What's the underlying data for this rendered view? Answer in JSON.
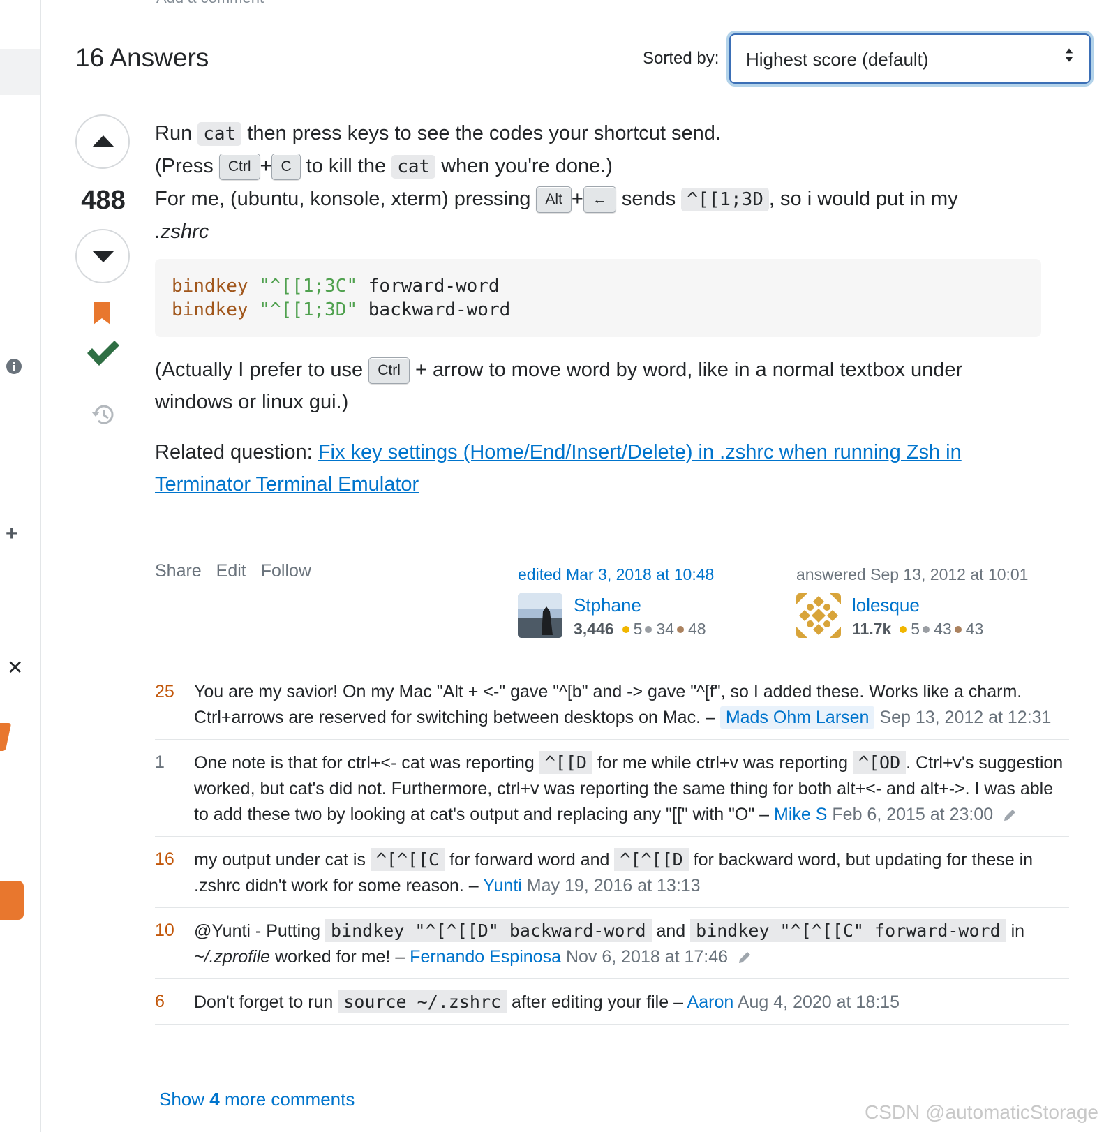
{
  "top_link": "Add a comment",
  "answers_header": {
    "count_label": "16 Answers",
    "sort_label": "Sorted by:",
    "sort_value": "Highest score (default)"
  },
  "answer": {
    "score": "488",
    "body": {
      "p1_a": "Run ",
      "p1_code": "cat",
      "p1_b": " then press keys to see the codes your shortcut send.",
      "p2_a": "(Press ",
      "key_ctrl": "Ctrl",
      "plus": "+",
      "key_c": "C",
      "p2_b": " to kill the ",
      "p2_code": "cat",
      "p2_c": " when you're done.)",
      "p3_a": "For me, (ubuntu, konsole, xterm) pressing ",
      "key_alt": "Alt",
      "key_left": "←",
      "p3_b": " sends ",
      "p3_code": "^[[1;3D",
      "p3_c": ", so i would put in my",
      "p3_d": ".zshrc",
      "code_line1_kw": "bindkey",
      "code_line1_str": "\"^[[1;3C\"",
      "code_line1_rest": " forward-word",
      "code_line2_kw": "bindkey",
      "code_line2_str": "\"^[[1;3D\"",
      "code_line2_rest": " backward-word",
      "p4_a": "(Actually I prefer to use ",
      "p4_b": " + arrow to move word by word, like in a normal textbox under",
      "p4_c": "windows or linux gui.)",
      "p5_a": "Related question: ",
      "p5_link1": "Fix key settings (Home/End/Insert/Delete) in .zshrc when running Zsh in",
      "p5_link2": "Terminator Terminal Emulator"
    },
    "menu": [
      "Share",
      "Edit",
      "Follow"
    ],
    "editor": {
      "action": "edited Mar 3, 2018 at 10:48",
      "name": "Stphane",
      "rep": "3,446",
      "gold": "5",
      "silver": "34",
      "bronze": "48"
    },
    "author": {
      "action": "answered Sep 13, 2012 at 10:01",
      "name": "lolesque",
      "rep": "11.7k",
      "gold": "5",
      "silver": "43",
      "bronze": "43"
    }
  },
  "comments": [
    {
      "score": "25",
      "text_a": "You are my savior! On my Mac \"Alt + <-\" gave \"^[b\" and -> gave \"^[f\", so I added these. Works like a charm. Ctrl+arrows are reserved for switching between desktops on Mac. – ",
      "user": "Mads Ohm Larsen",
      "date": "Sep 13, 2012 at 12:31"
    },
    {
      "score": "1",
      "text_a": "One note is that for ctrl+<- cat was reporting ",
      "code_a": "^[[D",
      "text_b": " for me while ctrl+v was reporting ",
      "code_b": "^[OD",
      "text_c": ". Ctrl+v's suggestion worked, but cat's did not. Furthermore, ctrl+v was reporting the same thing for both alt+<- and alt+->. I was able to add these two by looking at cat's output and replacing any \"[[\" with \"O\" – ",
      "user": "Mike S",
      "date": "Feb 6, 2015 at 23:00"
    },
    {
      "score": "16",
      "text_a": "my output under cat is ",
      "code_a": "^[^[[C",
      "text_b": " for forward word and ",
      "code_b": "^[^[[D",
      "text_c": " for backward word, but updating for these in .zshrc didn't work for some reason. – ",
      "user": "Yunti",
      "date": "May 19, 2016 at 13:13"
    },
    {
      "score": "10",
      "text_a": "@Yunti - Putting ",
      "code_a": "bindkey \"^[^[[D\" backward-word",
      "text_b": " and ",
      "code_b": "bindkey \"^[^[[C\" forward-word",
      "text_c": " in ",
      "text_em": "~/.zprofile",
      "text_d": " worked for me! – ",
      "user": "Fernando Espinosa",
      "date": "Nov 6, 2018 at 17:46"
    },
    {
      "score": "6",
      "text_a": "Don't forget to run ",
      "code_a": "source ~/.zshrc",
      "text_b": " after editing your file – ",
      "user": "Aaron",
      "date": "Aug 4, 2020 at 18:15"
    }
  ],
  "show_more": {
    "pre": "Show ",
    "count": "4",
    "post": " more comments"
  },
  "watermark": "CSDN @automaticStorage",
  "colors": {
    "accent_blue": "#0074cc",
    "accepted_green": "#2f6f44",
    "bookmark_orange": "#e8772e",
    "comment_score_orange": "#c2570a"
  },
  "icons": [
    "info-icon",
    "plus-icon",
    "close-icon",
    "bookmark-icon",
    "accepted-check-icon",
    "history-icon",
    "pencil-icon",
    "sort-chevrons-icon"
  ]
}
